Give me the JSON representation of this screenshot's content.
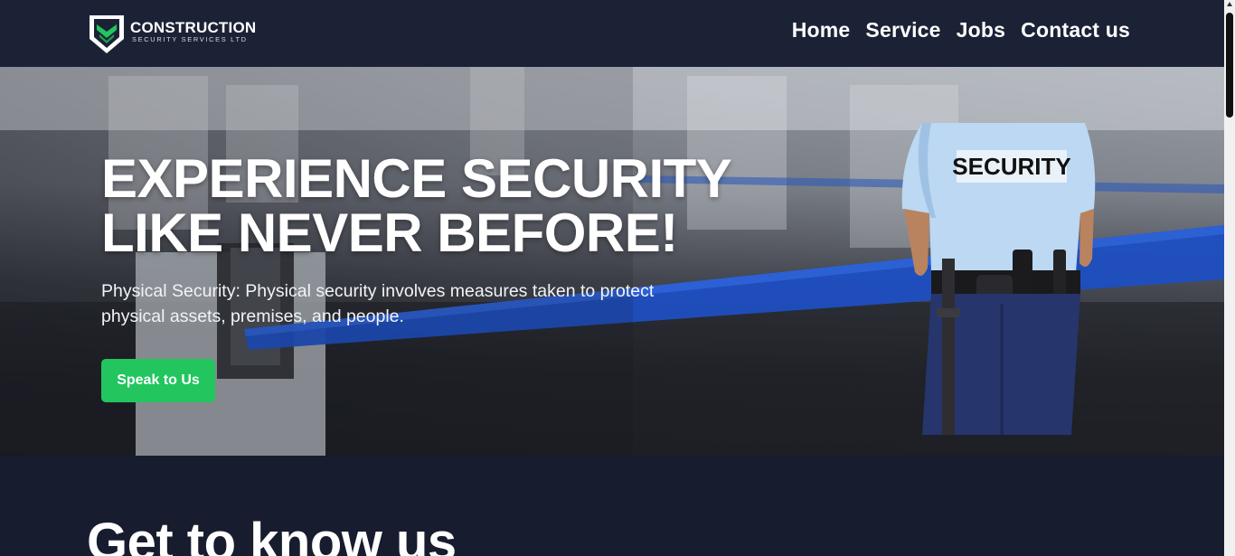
{
  "header": {
    "logo": {
      "title": "CONSTRUCTION",
      "subtitle": "SECURITY SERVICES LTD"
    },
    "nav": [
      "Home",
      "Service",
      "Jobs",
      "Contact us"
    ]
  },
  "hero": {
    "title_line1": "EXPERIENCE SECURITY",
    "title_line2": "LIKE NEVER BEFORE!",
    "text": "Physical Security: Physical security involves measures taken to protect physical assets, premises, and people.",
    "cta": "Speak to Us",
    "guard_shirt_label": "SECURITY"
  },
  "section": {
    "title": "Get to know us"
  },
  "colors": {
    "header_bg": "#1c2236",
    "page_bg": "#171c2e",
    "accent_green": "#22c55e",
    "rope_blue": "#1e4fc2"
  },
  "icons": {
    "logo": "shield-check-icon"
  }
}
